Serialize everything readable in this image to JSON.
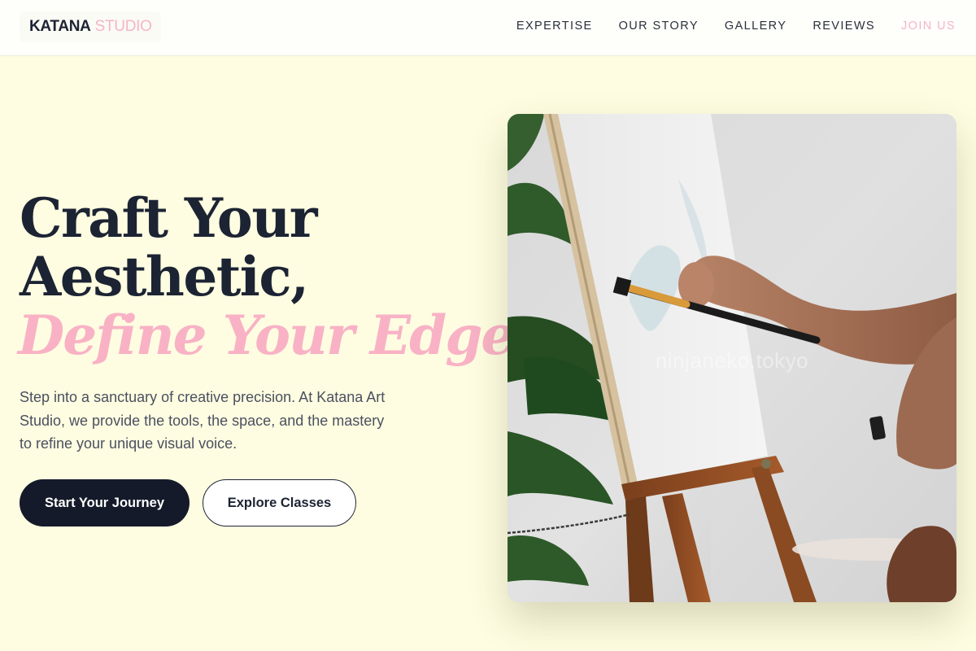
{
  "header": {
    "logo": {
      "brand": "KATANA",
      "sub": "STUDIO"
    },
    "nav": [
      {
        "label": "EXPERTISE"
      },
      {
        "label": "OUR STORY"
      },
      {
        "label": "GALLERY"
      },
      {
        "label": "REVIEWS"
      },
      {
        "label": "JOIN US"
      }
    ]
  },
  "hero": {
    "headline_line1": "Craft Your",
    "headline_line2": "Aesthetic,",
    "headline_accent": "Define Your Edge.",
    "description": "Step into a sanctuary of creative precision. At Katana Art Studio, we provide the tools, the space, and the mastery to refine your unique visual voice.",
    "primary_button": "Start Your Journey",
    "secondary_button": "Explore Classes",
    "image": {
      "subject": "artist-painting-at-easel-image",
      "watermark": "ninjaneko.tokyo"
    }
  },
  "colors": {
    "page_background": "#fefde1",
    "header_background": "#fefefb",
    "heading_dark": "#1c2333",
    "accent_pink": "#f9b2c5",
    "body_text": "#4b5060",
    "button_dark": "#151a2a"
  }
}
